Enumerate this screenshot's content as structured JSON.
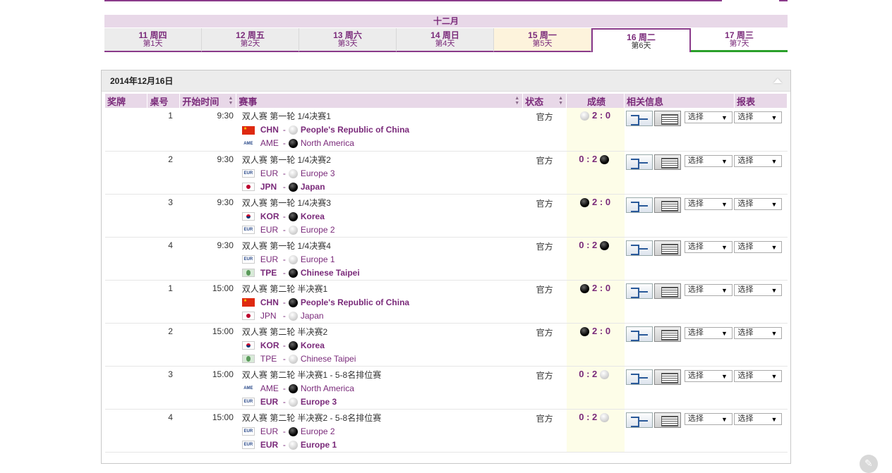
{
  "month": "十二月",
  "days": [
    {
      "date": "11 周四",
      "day": "第1天",
      "state": "normal"
    },
    {
      "date": "12 周五",
      "day": "第2天",
      "state": "normal"
    },
    {
      "date": "13 周六",
      "day": "第3天",
      "state": "normal"
    },
    {
      "date": "14 周日",
      "day": "第4天",
      "state": "normal"
    },
    {
      "date": "15 周一",
      "day": "第5天",
      "state": "past"
    },
    {
      "date": "16 周二",
      "day": "第6天",
      "state": "active"
    },
    {
      "date": "17 周三",
      "day": "第7天",
      "state": "future"
    }
  ],
  "panel_title": "2014年12月16日",
  "headers": {
    "medal": "奖牌",
    "table": "桌号",
    "start": "开始时间",
    "event": "赛事",
    "status": "状态",
    "result": "成绩",
    "info": "相关信息",
    "report": "报表"
  },
  "select_label": "选择",
  "matches": [
    {
      "table": "1",
      "time": "9:30",
      "event": "双人赛 第一轮 1/4决赛1",
      "status": "官方",
      "t1": {
        "flag": "chn",
        "flag_text": "",
        "code": "CHN",
        "stone": "white",
        "name": "People's Republic of China",
        "win": true
      },
      "t2": {
        "flag": "ame",
        "flag_text": "AME",
        "code": "AME",
        "stone": "black",
        "name": "North America",
        "win": false
      },
      "result": "2 : 0",
      "rstone": "white",
      "rpos": "left"
    },
    {
      "table": "2",
      "time": "9:30",
      "event": "双人赛 第一轮 1/4决赛2",
      "status": "官方",
      "t1": {
        "flag": "eur",
        "flag_text": "EUR",
        "code": "EUR",
        "stone": "white",
        "name": "Europe 3",
        "win": false
      },
      "t2": {
        "flag": "jpn",
        "flag_text": "",
        "code": "JPN",
        "stone": "black",
        "name": "Japan",
        "win": true
      },
      "result": "0 : 2",
      "rstone": "black",
      "rpos": "right"
    },
    {
      "table": "3",
      "time": "9:30",
      "event": "双人赛 第一轮 1/4决赛3",
      "status": "官方",
      "t1": {
        "flag": "kor",
        "flag_text": "",
        "code": "KOR",
        "stone": "black",
        "name": "Korea",
        "win": true
      },
      "t2": {
        "flag": "eur",
        "flag_text": "EUR",
        "code": "EUR",
        "stone": "white",
        "name": "Europe 2",
        "win": false
      },
      "result": "2 : 0",
      "rstone": "black",
      "rpos": "left"
    },
    {
      "table": "4",
      "time": "9:30",
      "event": "双人赛 第一轮 1/4决赛4",
      "status": "官方",
      "t1": {
        "flag": "eur",
        "flag_text": "EUR",
        "code": "EUR",
        "stone": "white",
        "name": "Europe 1",
        "win": false
      },
      "t2": {
        "flag": "tpe",
        "flag_text": "",
        "code": "TPE",
        "stone": "black",
        "name": "Chinese Taipei",
        "win": true
      },
      "result": "0 : 2",
      "rstone": "black",
      "rpos": "right"
    },
    {
      "table": "1",
      "time": "15:00",
      "event": "双人赛 第二轮 半决赛1",
      "status": "官方",
      "t1": {
        "flag": "chn",
        "flag_text": "",
        "code": "CHN",
        "stone": "black",
        "name": "People's Republic of China",
        "win": true
      },
      "t2": {
        "flag": "jpn",
        "flag_text": "",
        "code": "JPN",
        "stone": "white",
        "name": "Japan",
        "win": false
      },
      "result": "2 : 0",
      "rstone": "black",
      "rpos": "left"
    },
    {
      "table": "2",
      "time": "15:00",
      "event": "双人赛 第二轮 半决赛2",
      "status": "官方",
      "t1": {
        "flag": "kor",
        "flag_text": "",
        "code": "KOR",
        "stone": "black",
        "name": "Korea",
        "win": true
      },
      "t2": {
        "flag": "tpe",
        "flag_text": "",
        "code": "TPE",
        "stone": "white",
        "name": "Chinese Taipei",
        "win": false
      },
      "result": "2 : 0",
      "rstone": "black",
      "rpos": "left"
    },
    {
      "table": "3",
      "time": "15:00",
      "event": "双人赛 第二轮 半决赛1 - 5-8名排位赛",
      "status": "官方",
      "t1": {
        "flag": "ame",
        "flag_text": "AME",
        "code": "AME",
        "stone": "black",
        "name": "North America",
        "win": false
      },
      "t2": {
        "flag": "eur",
        "flag_text": "EUR",
        "code": "EUR",
        "stone": "white",
        "name": "Europe 3",
        "win": true
      },
      "result": "0 : 2",
      "rstone": "white",
      "rpos": "right"
    },
    {
      "table": "4",
      "time": "15:00",
      "event": "双人赛 第二轮 半决赛2 - 5-8名排位赛",
      "status": "官方",
      "t1": {
        "flag": "eur",
        "flag_text": "EUR",
        "code": "EUR",
        "stone": "black",
        "name": "Europe 2",
        "win": false
      },
      "t2": {
        "flag": "eur",
        "flag_text": "EUR",
        "code": "EUR",
        "stone": "white",
        "name": "Europe 1",
        "win": true
      },
      "result": "0 : 2",
      "rstone": "white",
      "rpos": "right"
    }
  ]
}
